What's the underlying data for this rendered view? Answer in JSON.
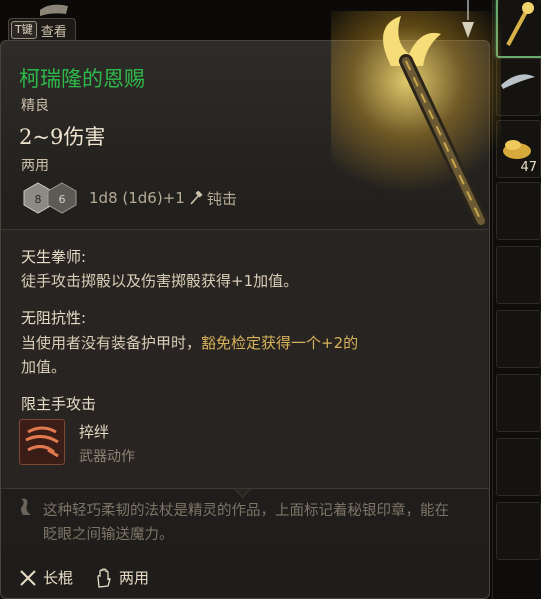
{
  "tab": {
    "key": "T键",
    "label": "查看"
  },
  "item": {
    "name": "柯瑞隆的恩赐",
    "rarity": "精良",
    "damage": "2~9伤害",
    "hands": "两用",
    "dice": {
      "die1": "8",
      "die2": "6",
      "formula": "1d8 (1d6)+1",
      "type": "钝击"
    }
  },
  "passive1": {
    "title": "天生拳师:",
    "text": "徒手攻击掷骰以及伤害掷骰获得+1加值。"
  },
  "passive2": {
    "title": "无阻抗性:",
    "text_a": "当使用者没有装备护甲时，",
    "text_b": "豁免检定获得一个+2的",
    "text_c": "加值。"
  },
  "limit": "限主手攻击",
  "action": {
    "name": "捽绊",
    "type": "武器动作"
  },
  "lore": "这种轻巧柔韧的法杖是精灵的作品，上面标记着秘银印章，能在眨眼之间输送魔力。",
  "footer": {
    "weapon_type": "长棍",
    "hands": "两用"
  },
  "inventory": {
    "count": "47"
  },
  "colors": {
    "name": "#2fb84a",
    "gold": "#d8b25a",
    "panel": "#2a2825"
  }
}
